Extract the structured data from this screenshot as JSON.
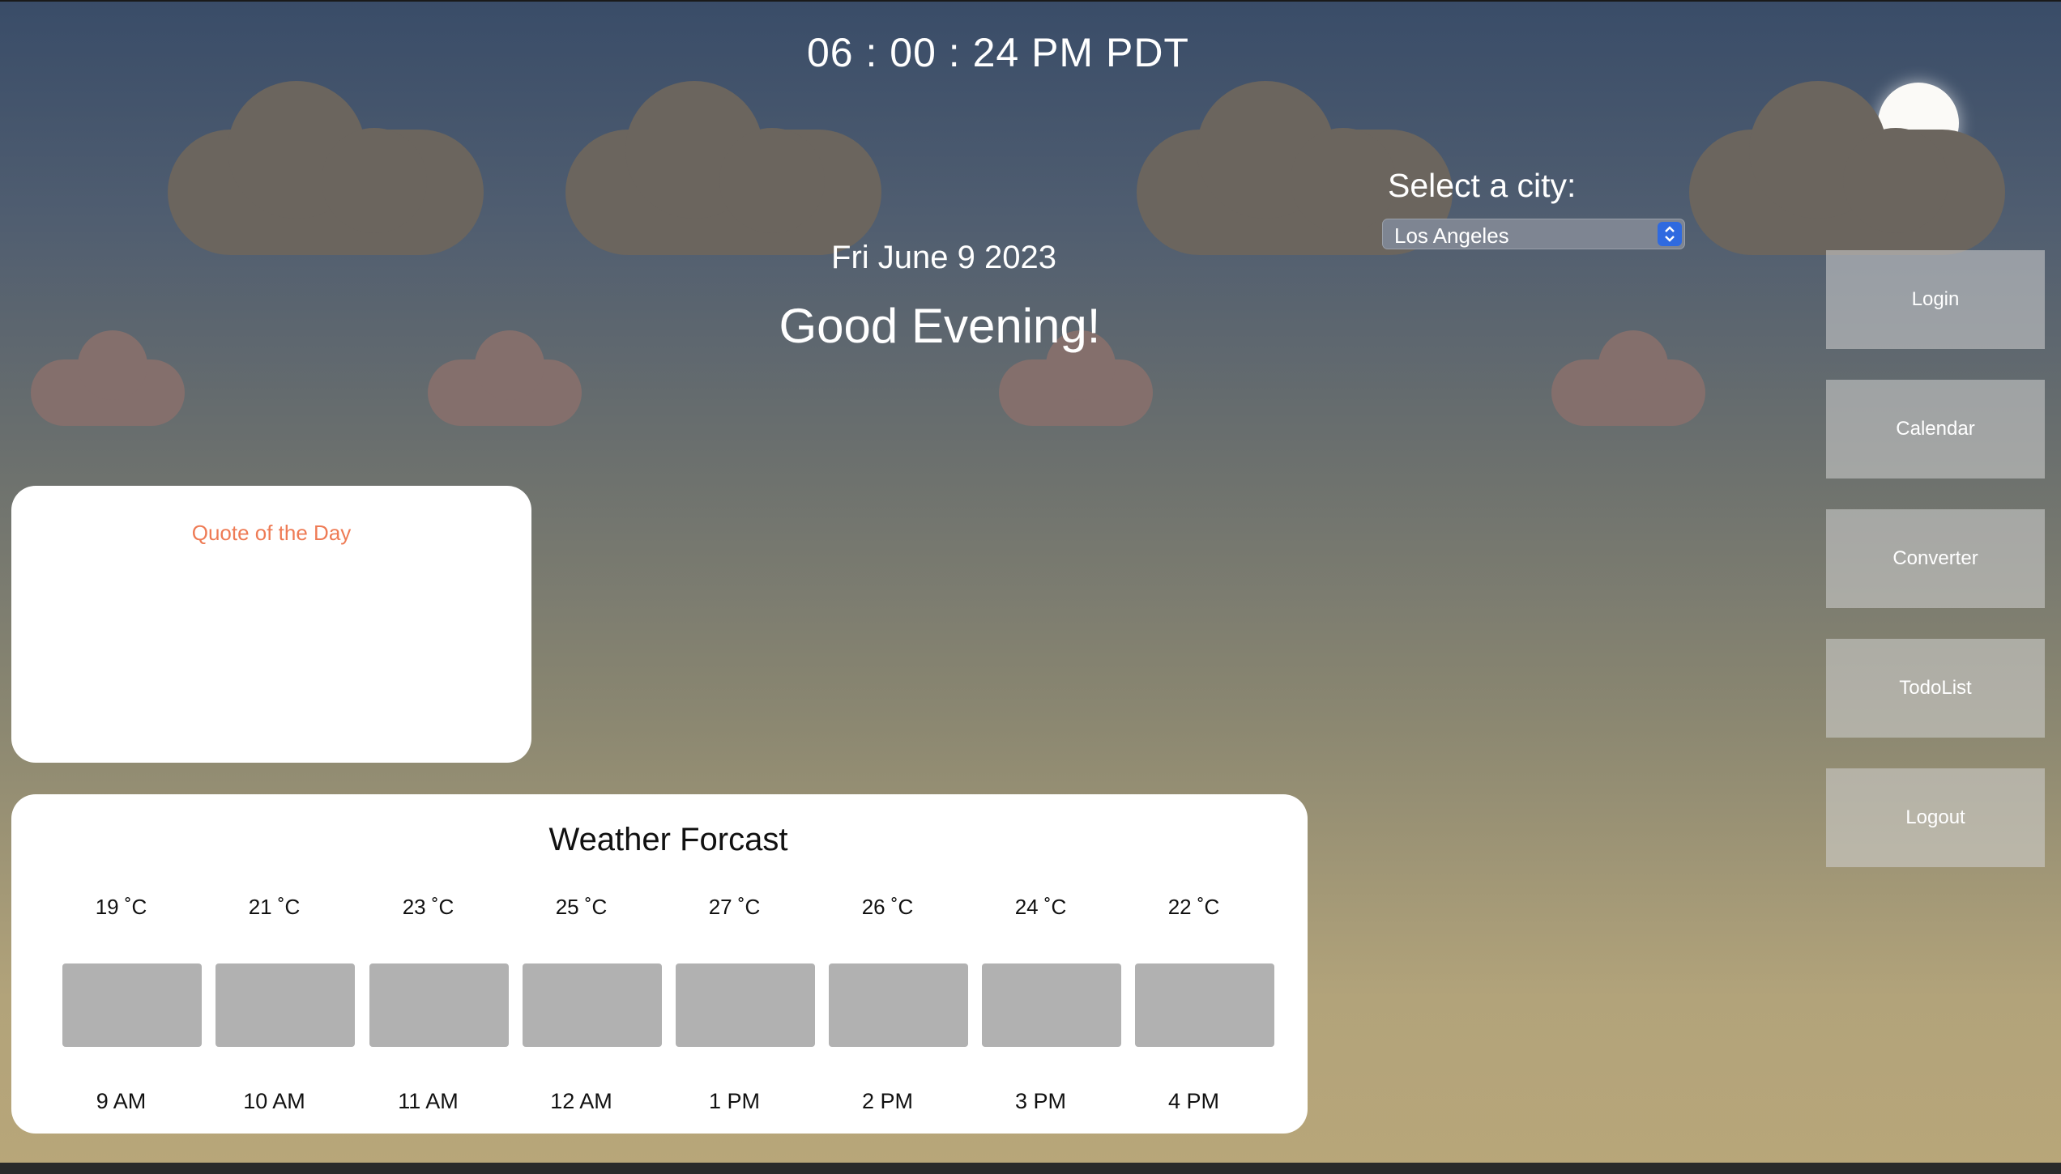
{
  "clock": {
    "time": "06 : 00 : 24 PM PDT"
  },
  "date": "Fri June 9 2023",
  "greeting": "Good Evening!",
  "city_select": {
    "label": "Select a city:",
    "value": "Los Angeles"
  },
  "nav": {
    "login": "Login",
    "calendar": "Calendar",
    "converter": "Converter",
    "todolist": "TodoList",
    "logout": "Logout"
  },
  "quote": {
    "title": "Quote of the Day"
  },
  "forecast": {
    "title": "Weather Forcast",
    "items": [
      {
        "temp": "19 ˚C",
        "hour": "9 AM"
      },
      {
        "temp": "21 ˚C",
        "hour": "10 AM"
      },
      {
        "temp": "23 ˚C",
        "hour": "11 AM"
      },
      {
        "temp": "25 ˚C",
        "hour": "12 AM"
      },
      {
        "temp": "27 ˚C",
        "hour": "1 PM"
      },
      {
        "temp": "26 ˚C",
        "hour": "2 PM"
      },
      {
        "temp": "24 ˚C",
        "hour": "3 PM"
      },
      {
        "temp": "22 ˚C",
        "hour": "4 PM"
      }
    ]
  },
  "icons": [
    "cloud-icon",
    "sun-icon",
    "chevron-updown-icon"
  ],
  "colors": {
    "quote_title": "#ee7b55",
    "select_arrow": "#2f6ae0",
    "bar": "#b1b1b1"
  }
}
